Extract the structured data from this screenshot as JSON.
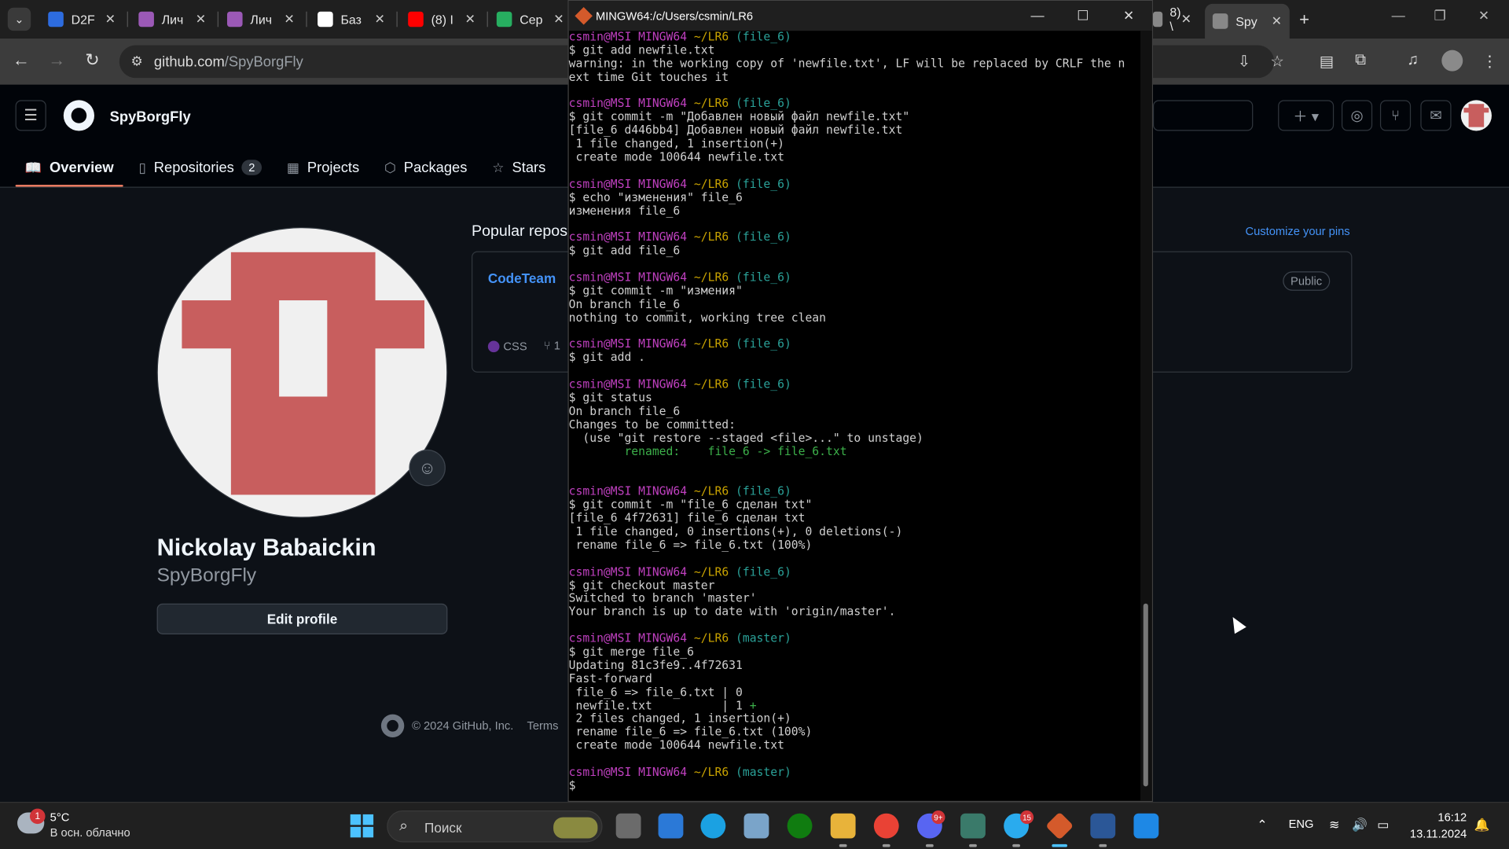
{
  "browser": {
    "tabs": [
      {
        "label": "D2F",
        "color": "#2d6cdf"
      },
      {
        "label": "Лич",
        "color": "#9b59b6"
      },
      {
        "label": "Лич",
        "color": "#9b59b6"
      },
      {
        "label": "Баз",
        "color": "#ffffff"
      },
      {
        "label": "(8) I",
        "color": "#ff0000"
      },
      {
        "label": "Сер",
        "color": "#27ae60"
      },
      {
        "label": "8) \\",
        "color": "#888888"
      },
      {
        "label": "Spy",
        "color": "#888888"
      }
    ],
    "close_glyph": "✕",
    "url_host": "github.com",
    "url_path": "/SpyBorgFly"
  },
  "github": {
    "username": "SpyBorgFly",
    "nav": {
      "overview": "Overview",
      "repositories": "Repositories",
      "repositories_count": "2",
      "projects": "Projects",
      "packages": "Packages",
      "stars": "Stars"
    },
    "profile": {
      "full_name": "Nickolay Babaickin",
      "login": "SpyBorgFly",
      "edit_button": "Edit profile"
    },
    "popular": {
      "title": "Popular repos",
      "customize": "Customize your pins",
      "repo_name": "CodeTeam",
      "visibility": "Public",
      "language": "CSS",
      "language_color": "#663399",
      "forks": "1"
    },
    "footer": {
      "copyright": "© 2024 GitHub, Inc.",
      "terms": "Terms"
    }
  },
  "terminal": {
    "title": "MINGW64:/c/Users/csmin/LR6",
    "lines": [
      {
        "type": "prompt",
        "user": "csmin@MSI",
        "env": "MINGW64",
        "path": "~/LR6",
        "branch": "(file_6)"
      },
      {
        "type": "out",
        "text": "$ git add newfile.txt"
      },
      {
        "type": "out",
        "text": "warning: in the working copy of 'newfile.txt', LF will be replaced by CRLF the n"
      },
      {
        "type": "out",
        "text": "ext time Git touches it"
      },
      {
        "type": "out",
        "text": ""
      },
      {
        "type": "prompt",
        "user": "csmin@MSI",
        "env": "MINGW64",
        "path": "~/LR6",
        "branch": "(file_6)"
      },
      {
        "type": "out",
        "text": "$ git commit -m \"Добавлен новый файл newfile.txt\""
      },
      {
        "type": "out",
        "text": "[file_6 d446bb4] Добавлен новый файл newfile.txt"
      },
      {
        "type": "out",
        "text": " 1 file changed, 1 insertion(+)"
      },
      {
        "type": "out",
        "text": " create mode 100644 newfile.txt"
      },
      {
        "type": "out",
        "text": ""
      },
      {
        "type": "prompt",
        "user": "csmin@MSI",
        "env": "MINGW64",
        "path": "~/LR6",
        "branch": "(file_6)"
      },
      {
        "type": "out",
        "text": "$ echo \"изменения\" file_6"
      },
      {
        "type": "out",
        "text": "изменения file_6"
      },
      {
        "type": "out",
        "text": ""
      },
      {
        "type": "prompt",
        "user": "csmin@MSI",
        "env": "MINGW64",
        "path": "~/LR6",
        "branch": "(file_6)"
      },
      {
        "type": "out",
        "text": "$ git add file_6"
      },
      {
        "type": "out",
        "text": ""
      },
      {
        "type": "prompt",
        "user": "csmin@MSI",
        "env": "MINGW64",
        "path": "~/LR6",
        "branch": "(file_6)"
      },
      {
        "type": "out",
        "text": "$ git commit -m \"измения\""
      },
      {
        "type": "out",
        "text": "On branch file_6"
      },
      {
        "type": "out",
        "text": "nothing to commit, working tree clean"
      },
      {
        "type": "out",
        "text": ""
      },
      {
        "type": "prompt",
        "user": "csmin@MSI",
        "env": "MINGW64",
        "path": "~/LR6",
        "branch": "(file_6)"
      },
      {
        "type": "out",
        "text": "$ git add ."
      },
      {
        "type": "out",
        "text": ""
      },
      {
        "type": "prompt",
        "user": "csmin@MSI",
        "env": "MINGW64",
        "path": "~/LR6",
        "branch": "(file_6)"
      },
      {
        "type": "out",
        "text": "$ git status"
      },
      {
        "type": "out",
        "text": "On branch file_6"
      },
      {
        "type": "out",
        "text": "Changes to be committed:"
      },
      {
        "type": "out",
        "text": "  (use \"git restore --staged <file>...\" to unstage)"
      },
      {
        "type": "green",
        "text": "        renamed:    file_6 -> file_6.txt"
      },
      {
        "type": "out",
        "text": ""
      },
      {
        "type": "out",
        "text": ""
      },
      {
        "type": "prompt",
        "user": "csmin@MSI",
        "env": "MINGW64",
        "path": "~/LR6",
        "branch": "(file_6)"
      },
      {
        "type": "out",
        "text": "$ git commit -m \"file_6 сделан txt\""
      },
      {
        "type": "out",
        "text": "[file_6 4f72631] file_6 сделан txt"
      },
      {
        "type": "out",
        "text": " 1 file changed, 0 insertions(+), 0 deletions(-)"
      },
      {
        "type": "out",
        "text": " rename file_6 => file_6.txt (100%)"
      },
      {
        "type": "out",
        "text": ""
      },
      {
        "type": "prompt",
        "user": "csmin@MSI",
        "env": "MINGW64",
        "path": "~/LR6",
        "branch": "(file_6)"
      },
      {
        "type": "out",
        "text": "$ git checkout master"
      },
      {
        "type": "out",
        "text": "Switched to branch 'master'"
      },
      {
        "type": "out",
        "text": "Your branch is up to date with 'origin/master'."
      },
      {
        "type": "out",
        "text": ""
      },
      {
        "type": "prompt",
        "user": "csmin@MSI",
        "env": "MINGW64",
        "path": "~/LR6",
        "branch": "(master)"
      },
      {
        "type": "out",
        "text": "$ git merge file_6"
      },
      {
        "type": "out",
        "text": "Updating 81c3fe9..4f72631"
      },
      {
        "type": "out",
        "text": "Fast-forward"
      },
      {
        "type": "out",
        "text": " file_6 => file_6.txt | 0"
      },
      {
        "type": "stat",
        "text": " newfile.txt          | 1 ",
        "plus": "+"
      },
      {
        "type": "out",
        "text": " 2 files changed, 1 insertion(+)"
      },
      {
        "type": "out",
        "text": " rename file_6 => file_6.txt (100%)"
      },
      {
        "type": "out",
        "text": " create mode 100644 newfile.txt"
      },
      {
        "type": "out",
        "text": ""
      },
      {
        "type": "prompt",
        "user": "csmin@MSI",
        "env": "MINGW64",
        "path": "~/LR6",
        "branch": "(master)"
      },
      {
        "type": "out",
        "text": "$"
      }
    ]
  },
  "taskbar": {
    "weather_badge": "1",
    "temperature": "5°C",
    "weather_desc": "В осн. облачно",
    "search_placeholder": "Поиск",
    "discord_badge": "9+",
    "telegram_badge": "15",
    "lang": "ENG",
    "time": "16:12",
    "date": "13.11.2024"
  }
}
